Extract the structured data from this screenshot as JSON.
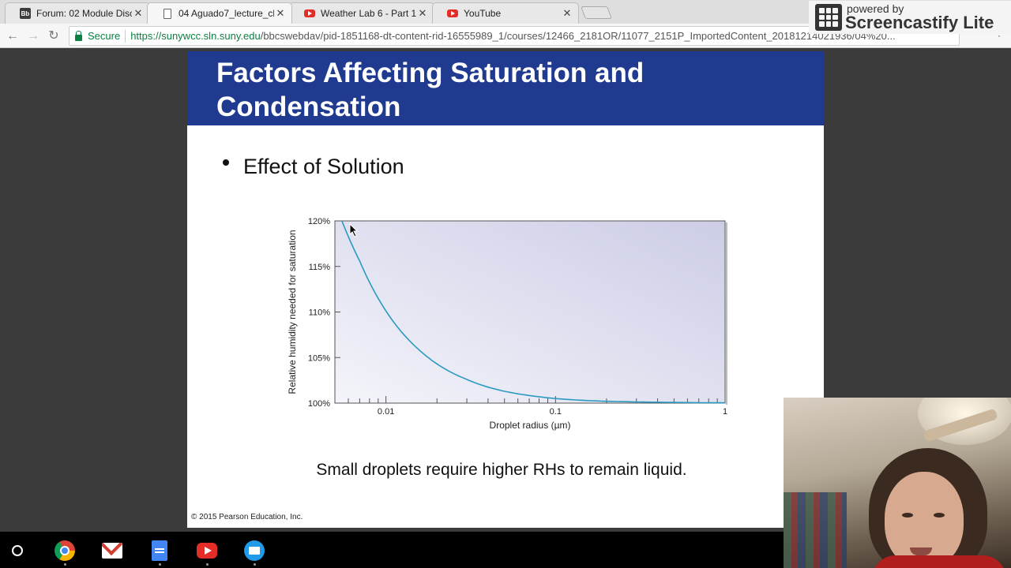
{
  "browser": {
    "tabs": [
      {
        "title": "Forum: 02 Module Discu",
        "favicon": "blackboard-icon",
        "active": false
      },
      {
        "title": "04 Aguado7_lecture_ch_",
        "favicon": "document-icon",
        "active": true
      },
      {
        "title": "Weather Lab 6 - Part 1 -",
        "favicon": "youtube-icon",
        "active": false
      },
      {
        "title": "YouTube",
        "favicon": "youtube-icon",
        "active": false
      }
    ],
    "close_glyph": "✕",
    "secure_label": "Secure",
    "url_host": "https://sunywcc.sln.suny.edu",
    "url_path": "/bbcswebdav/pid-1851168-dt-content-rid-16555989_1/courses/12466_2181OR/11077_2151P_ImportedContent_20181214021936/04%20..."
  },
  "screencastify": {
    "top_text": "powered by",
    "brand_text": "Screencastify Lite"
  },
  "slide": {
    "title": "Factors Affecting Saturation and Condensation",
    "bullet": "Effect of Solution",
    "caption": "Small droplets require higher RHs to remain liquid.",
    "copyright": "© 2015 Pearson Education, Inc.",
    "header_color": "#1f3a8f"
  },
  "chart_data": {
    "type": "line",
    "xlabel": "Droplet radius (µm)",
    "ylabel": "Relative humidity needed for saturation",
    "x_scale": "log",
    "xlim": [
      0.005,
      1
    ],
    "ylim": [
      100,
      120
    ],
    "x_tick_labels": [
      "0.01",
      "0.1",
      "1"
    ],
    "x_tick_values": [
      0.01,
      0.1,
      1
    ],
    "y_tick_labels": [
      "120%",
      "115%",
      "110%",
      "105%",
      "100%"
    ],
    "y_tick_values": [
      120,
      115,
      110,
      105,
      100
    ],
    "series": [
      {
        "color": "#2a9ac0",
        "x": [
          0.0055,
          0.007,
          0.009,
          0.012,
          0.016,
          0.02,
          0.03,
          0.05,
          0.08,
          0.1,
          0.2,
          0.4,
          0.7,
          1.0
        ],
        "y": [
          120,
          115.6,
          111.5,
          108.1,
          105.7,
          104.3,
          102.6,
          101.3,
          100.7,
          100.5,
          100.2,
          100.1,
          100.05,
          100.03
        ]
      }
    ]
  },
  "taskbar": {
    "apps": [
      "chrome-icon",
      "gmail-icon",
      "google-docs-icon",
      "youtube-icon",
      "files-icon"
    ]
  }
}
